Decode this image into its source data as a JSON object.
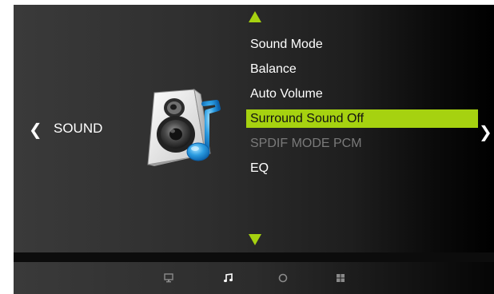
{
  "section": {
    "title": "SOUND",
    "icon": "speaker-music-note-icon"
  },
  "navigation": {
    "left_arrow": "❮",
    "right_arrow": "❯",
    "up_arrow_icon": "triangle-up-icon",
    "down_arrow_icon": "triangle-down-icon"
  },
  "menu": {
    "items": [
      {
        "label": "Sound Mode",
        "state": "normal"
      },
      {
        "label": "Balance",
        "state": "normal"
      },
      {
        "label": "Auto Volume",
        "state": "normal"
      },
      {
        "label": "Surround Sound Off",
        "state": "selected"
      },
      {
        "label": "SPDIF MODE PCM",
        "state": "disabled"
      },
      {
        "label": "EQ",
        "state": "normal"
      }
    ]
  },
  "bottom_tabs": [
    {
      "icon": "monitor-icon",
      "active": false
    },
    {
      "icon": "music-note-icon",
      "active": true
    },
    {
      "icon": "clock-icon",
      "active": false
    },
    {
      "icon": "grid-icon",
      "active": false
    }
  ],
  "colors": {
    "accent": "#a6d210",
    "text": "#ffffff",
    "disabled_text": "#7a7a7a"
  }
}
